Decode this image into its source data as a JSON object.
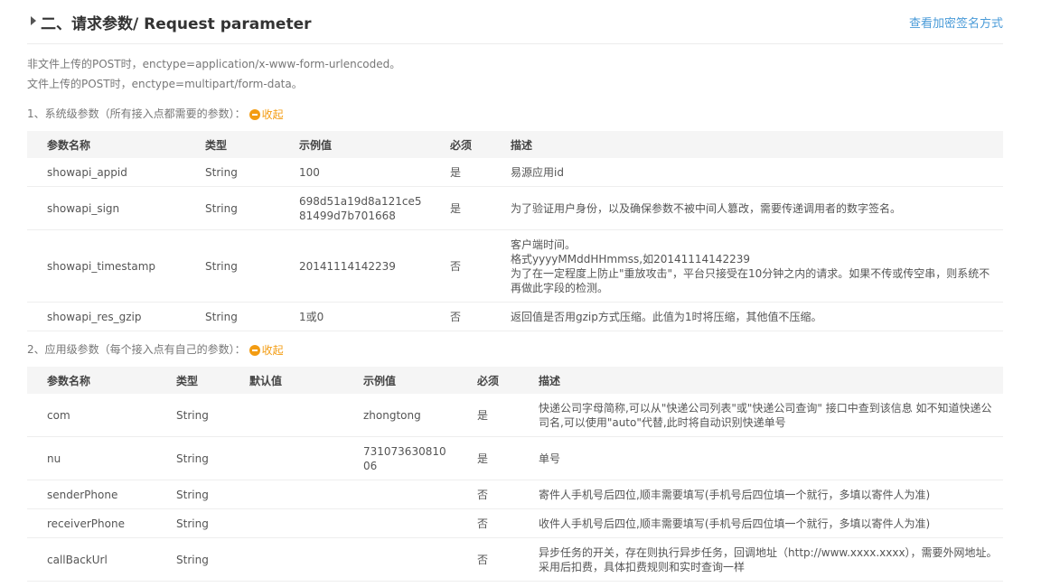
{
  "header": {
    "title": "二、请求参数/ Request parameter",
    "link": "查看加密签名方式"
  },
  "notes": [
    "非文件上传的POST时，enctype=application/x-www-form-urlencoded。",
    "文件上传的POST时，enctype=multipart/form-data。"
  ],
  "system_section": {
    "title": "1、系统级参数（所有接入点都需要的参数）：",
    "collapse_label": "收起",
    "columns": [
      "参数名称",
      "类型",
      "示例值",
      "必须",
      "描述"
    ],
    "rows": [
      {
        "name": "showapi_appid",
        "type": "String",
        "example": "100",
        "required": "是",
        "desc": "易源应用id"
      },
      {
        "name": "showapi_sign",
        "type": "String",
        "example": "698d51a19d8a121ce5\n81499d7b701668",
        "required": "是",
        "desc": "为了验证用户身份，以及确保参数不被中间人篡改，需要传递调用者的数字签名。"
      },
      {
        "name": "showapi_timestamp",
        "type": "String",
        "example": "20141114142239",
        "required": "否",
        "desc": "客户端时间。\n格式yyyyMMddHHmmss,如20141114142239\n为了在一定程度上防止\"重放攻击\"，平台只接受在10分钟之内的请求。如果不传或传空串，则系统不再做此字段的检测。"
      },
      {
        "name": "showapi_res_gzip",
        "type": "String",
        "example": "1或0",
        "required": "否",
        "desc": "返回值是否用gzip方式压缩。此值为1时将压缩，其他值不压缩。"
      }
    ]
  },
  "app_section": {
    "title": "2、应用级参数（每个接入点有自己的参数）：",
    "collapse_label": "收起",
    "columns": [
      "参数名称",
      "类型",
      "默认值",
      "示例值",
      "必须",
      "描述"
    ],
    "rows": [
      {
        "name": "com",
        "type": "String",
        "default": "",
        "example": "zhongtong",
        "required": "是",
        "desc": "快递公司字母简称,可以从\"快递公司列表\"或\"快递公司查询\" 接口中查到该信息 如不知道快递公司名,可以使用\"auto\"代替,此时将自动识别快递单号"
      },
      {
        "name": "nu",
        "type": "String",
        "default": "",
        "example": "731073630810\n06",
        "required": "是",
        "desc": "单号"
      },
      {
        "name": "senderPhone",
        "type": "String",
        "default": "",
        "example": "",
        "required": "否",
        "desc": "寄件人手机号后四位,顺丰需要填写(手机号后四位填一个就行，多填以寄件人为准)"
      },
      {
        "name": "receiverPhone",
        "type": "String",
        "default": "",
        "example": "",
        "required": "否",
        "desc": "收件人手机号后四位,顺丰需要填写(手机号后四位填一个就行，多填以寄件人为准)"
      },
      {
        "name": "callBackUrl",
        "type": "String",
        "default": "",
        "example": "",
        "required": "否",
        "desc": "异步任务的开关，存在则执行异步任务，回调地址（http://www.xxxx.xxxx），需要外网地址。采用后扣费，具体扣费规则和实时查询一样"
      }
    ]
  }
}
